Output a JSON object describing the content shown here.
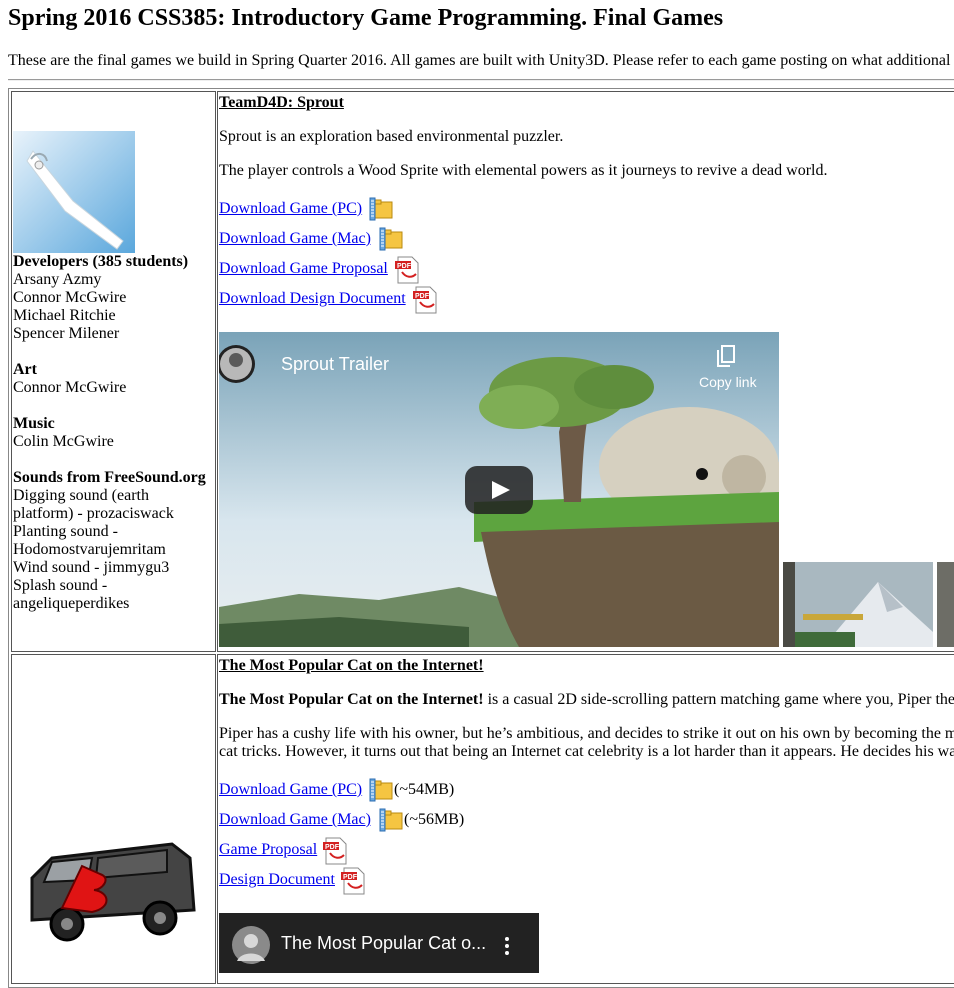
{
  "page": {
    "title": "Spring 2016 CSS385: Introductory Game Programming. Final Games",
    "intro": "These are the final games we build in Spring Quarter 2016. All games are built with Unity3D. Please refer to each game posting on what additional"
  },
  "game1": {
    "title": "TeamD4D: Sprout",
    "desc1": "Sprout is an exploration based environmental puzzler.",
    "desc2": "The player controls a Wood Sprite with elemental powers as it journeys to revive a dead world.",
    "links": {
      "pc": "Download Game (PC) ",
      "mac": "Download Game (Mac) ",
      "proposal": "Download Game Proposal ",
      "design": "Download Design Document "
    },
    "video": {
      "title": "Sprout Trailer",
      "copy_link": "Copy link"
    },
    "credits": {
      "dev_heading": "Developers (385 students)",
      "devs": [
        "Arsany Azmy",
        "Connor McGwire",
        "Michael Ritchie",
        "Spencer Milener"
      ],
      "art_heading": "Art",
      "art": [
        "Connor McGwire"
      ],
      "music_heading": "Music",
      "music": [
        "Colin McGwire"
      ],
      "sounds_heading": "Sounds from FreeSound.org",
      "sounds": [
        "Digging sound (earth",
        "platform) - prozaciswack",
        "Planting sound -",
        "Hodomostvarujemritam",
        "Wind sound - jimmygu3",
        "Splash sound -",
        "angeliqueperdikes"
      ]
    }
  },
  "game2": {
    "title": "The Most Popular Cat on the Internet!",
    "desc1_bold": "The Most Popular Cat on the Internet!",
    "desc1_rest": " is a casual 2D side-scrolling pattern matching game where you, Piper the",
    "desc2_line1": "Piper has a cushy life with his owner, but he’s ambitious, and decides to strike it out on his own by becoming the m",
    "desc2_line2": "cat tricks. However, it turns out that being an Internet cat celebrity is a lot harder than it appears. He decides his wa",
    "links": {
      "pc": "Download Game (PC) ",
      "pc_size": " (~54MB)",
      "mac": "Download Game (Mac) ",
      "mac_size": " (~56MB)",
      "proposal": "Game Proposal ",
      "design": "Design Document "
    },
    "video": {
      "title": "The Most Popular Cat o..."
    }
  },
  "colors": {
    "link": "#0000ee",
    "border": "#555555"
  }
}
